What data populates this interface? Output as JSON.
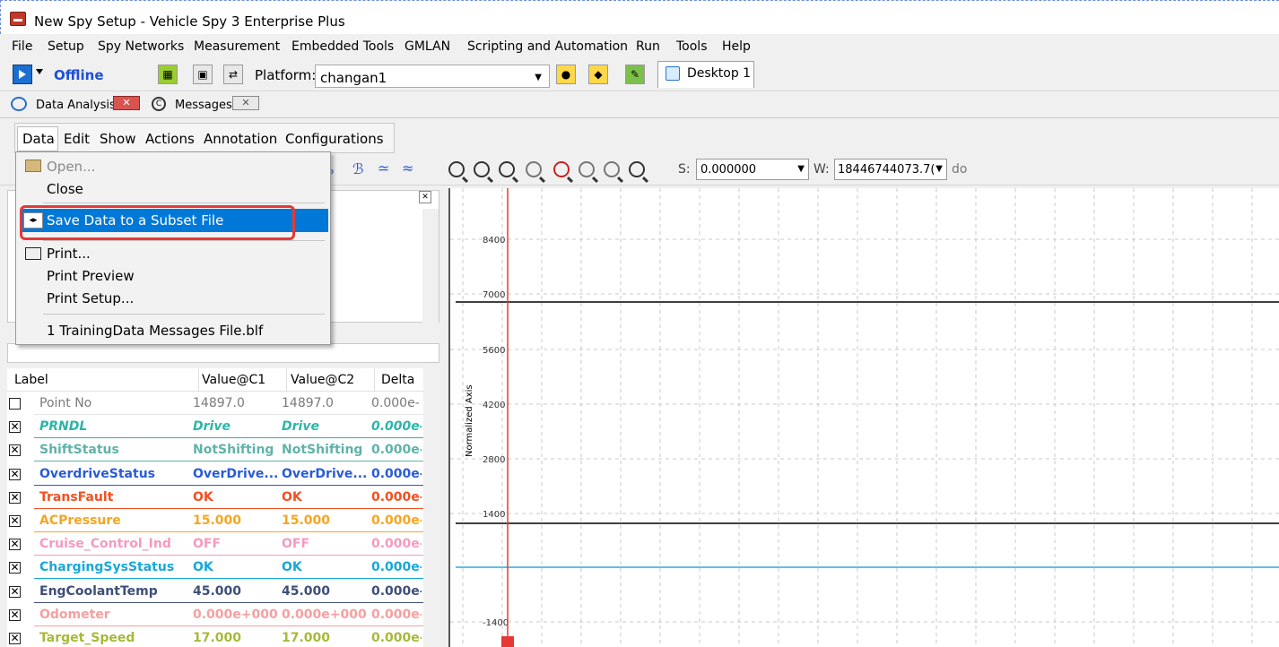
{
  "window": {
    "title": "New Spy Setup - Vehicle Spy 3 Enterprise Plus"
  },
  "menubar": [
    {
      "label": "File"
    },
    {
      "label": "Setup"
    },
    {
      "label": "Spy Networks"
    },
    {
      "label": "Measurement"
    },
    {
      "label": "Embedded Tools"
    },
    {
      "label": "GMLAN"
    },
    {
      "label": "Scripting and Automation"
    },
    {
      "label": "Run"
    },
    {
      "label": "Tools"
    },
    {
      "label": "Help"
    }
  ],
  "toolbar": {
    "status": "Offline",
    "platform_label": "Platform:",
    "platform_value": "changan1",
    "desktop_tab": "Desktop 1"
  },
  "doc_tabs": [
    {
      "label": "Data Analysis"
    },
    {
      "label": "Messages"
    }
  ],
  "inner_menu": [
    {
      "label": "Data"
    },
    {
      "label": "Edit"
    },
    {
      "label": "Show"
    },
    {
      "label": "Actions"
    },
    {
      "label": "Annotation"
    },
    {
      "label": "Configurations"
    }
  ],
  "data_menu": {
    "items": [
      {
        "label": "Open...",
        "disabled": true
      },
      {
        "label": "Close"
      },
      {
        "label": "Save Data to a Subset File",
        "highlighted": true
      },
      {
        "label": "Print..."
      },
      {
        "label": "Print Preview"
      },
      {
        "label": "Print Setup..."
      },
      {
        "label": "1 TrainingData Messages File.blf"
      }
    ]
  },
  "analysis_toolbar": {
    "s_label": "S:",
    "s_value": "0.000000",
    "w_label": "W:",
    "w_value": "18446744073.7(",
    "do_label": "do"
  },
  "table": {
    "headers": [
      "Label",
      "Value@C1",
      "Value@C2",
      "Delta"
    ],
    "rows": [
      {
        "checked": false,
        "label": "Point No",
        "v1": "14897.0",
        "v2": "14897.0",
        "delta": "0.000e-",
        "color": "#7a7a7a"
      },
      {
        "checked": true,
        "label": "PRNDL",
        "v1": "Drive",
        "v2": "Drive",
        "delta": "0.000e-",
        "color": "#2cb5a8",
        "italic": true
      },
      {
        "checked": true,
        "label": "ShiftStatus",
        "v1": "NotShifting",
        "v2": "NotShifting",
        "delta": "0.000e-",
        "color": "#5fb3a8"
      },
      {
        "checked": true,
        "label": "OverdriveStatus",
        "v1": "OverDrive...",
        "v2": "OverDrive...",
        "delta": "0.000e-",
        "color": "#2a5bd7"
      },
      {
        "checked": true,
        "label": "TransFault",
        "v1": "OK",
        "v2": "OK",
        "delta": "0.000e-",
        "color": "#f25022"
      },
      {
        "checked": true,
        "label": "ACPressure",
        "v1": "15.000",
        "v2": "15.000",
        "delta": "0.000e-",
        "color": "#f5a623"
      },
      {
        "checked": true,
        "label": "Cruise_Control_Ind",
        "v1": "OFF",
        "v2": "OFF",
        "delta": "0.000e-",
        "color": "#f49ac1"
      },
      {
        "checked": true,
        "label": "ChargingSysStatus",
        "v1": "OK",
        "v2": "OK",
        "delta": "0.000e-",
        "color": "#18a8d8"
      },
      {
        "checked": true,
        "label": "EngCoolantTemp",
        "v1": "45.000",
        "v2": "45.000",
        "delta": "0.000e-",
        "color": "#3f4f7a"
      },
      {
        "checked": true,
        "label": "Odometer",
        "v1": "0.000e+000",
        "v2": "0.000e+000",
        "delta": "0.000e-",
        "color": "#f4a0a0"
      },
      {
        "checked": true,
        "label": "Target_Speed",
        "v1": "17.000",
        "v2": "17.000",
        "delta": "0.000e-",
        "color": "#a8b83a"
      }
    ]
  },
  "chart_data": {
    "type": "line",
    "ylabel": "Normalized Axis",
    "y_ticks": [
      8400,
      7000,
      5600,
      4200,
      2800,
      1400,
      -1400
    ],
    "horizontal_lines": [
      {
        "y": 7000,
        "color": "#000000"
      },
      {
        "y": 1400,
        "color": "#000000"
      },
      {
        "y": 300,
        "color": "#2fa8d8"
      }
    ],
    "cursor_color": "#e53935",
    "grid": true
  }
}
